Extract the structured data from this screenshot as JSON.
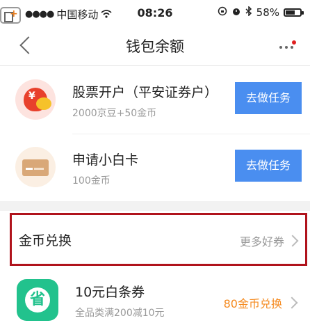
{
  "status_bar": {
    "carrier": "中国移动",
    "time": "08:26",
    "battery": "58%",
    "battery_level": 0.58
  },
  "nav": {
    "title": "钱包余额"
  },
  "tasks": [
    {
      "title": "股票开户（平安证券户）",
      "subtitle": "2000京豆+50金币",
      "button": "去做任务",
      "icon": "money-bag-icon"
    },
    {
      "title": "申请小白卡",
      "subtitle": "100金币",
      "button": "去做任务",
      "icon": "card-icon"
    }
  ],
  "exchange": {
    "title": "金币兑换",
    "more": "更多好券"
  },
  "coupons": [
    {
      "title": "10元白条券",
      "subtitle": "全品类满200减10元",
      "action": "80金币兑换",
      "glyph": "省"
    }
  ],
  "colors": {
    "primary_button": "#4a8ef0",
    "highlight_border": "#b0131c",
    "exchange_text": "#f58a1f",
    "coupon_icon": "#22c28d"
  }
}
